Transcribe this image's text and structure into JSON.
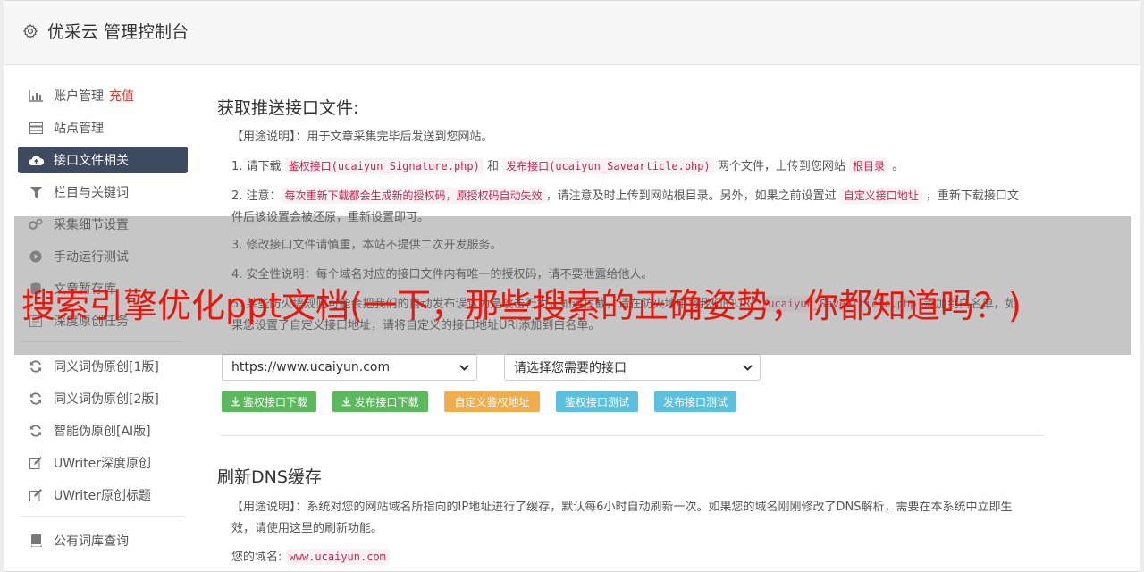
{
  "header": {
    "title": "优采云 管理控制台",
    "icon": "gear-icon"
  },
  "sidebar": {
    "items": [
      {
        "label": "账户管理",
        "badge": "充值",
        "icon": "bar-chart-icon"
      },
      {
        "label": "站点管理",
        "icon": "server-icon"
      },
      {
        "label": "接口文件相关",
        "icon": "cloud-upload-icon",
        "active": true
      },
      {
        "label": "栏目与关键词",
        "icon": "filter-icon"
      },
      {
        "label": "采集细节设置",
        "icon": "cogs-icon"
      },
      {
        "label": "手动运行测试",
        "icon": "play-circle-icon"
      },
      {
        "label": "文章暂存库",
        "icon": "database-icon"
      },
      {
        "label": "深度原创任务",
        "icon": "tasks-icon"
      },
      {
        "label": "同义词伪原创[1版]",
        "icon": "refresh-icon"
      },
      {
        "label": "同义词伪原创[2版]",
        "icon": "refresh-icon"
      },
      {
        "label": "智能伪原创[AI版]",
        "icon": "refresh-icon"
      },
      {
        "label": "UWriter深度原创",
        "icon": "edit-icon"
      },
      {
        "label": "UWriter原创标题",
        "icon": "edit-icon"
      },
      {
        "label": "公有词库查询",
        "icon": "book-icon"
      }
    ]
  },
  "section1": {
    "title": "获取推送接口文件:",
    "usage_label": "【用途说明】",
    "usage_text": "：用于文章采集完毕后发送到您网站。",
    "item1": {
      "prefix": "1. 请下载 ",
      "code1": "鉴权接口(ucaiyun_Signature.php)",
      "mid": " 和 ",
      "code2": "发布接口(ucaiyun_Savearticle.php)",
      "suffix": " 两个文件，上传到您网站 ",
      "code3": "根目录",
      "end": " 。"
    },
    "item2": {
      "prefix": "2. 注意：",
      "code1": "每次重新下载都会生成新的授权码，原授权码自动失效",
      "mid": "，请注意及时上传到网站根目录。另外，如果之前设置过 ",
      "code2": "自定义接口地址",
      "suffix": " ，重新下载接口文件后该设置会被还原，重新设置即可。"
    },
    "item3": "3. 修改接口文件请慎重，本站不提供二次开发服务。",
    "item4": "4. 安全性说明：每个域名对应的接口文件内有唯一的授权码，请不要泄露给他人。",
    "item5": {
      "text_a": "5. 某些防火墙规则可能会把我们的自动发布误认为是攻击行为，如遇拦截，请在防火墙中将我们的URI ",
      "code1": "/ucaiyun_Savearticle.php",
      "text_b": " 添加到白名单，如果您设置了自定义接口地址，请将自定义的接口地址URI添加到白名单。"
    },
    "site_select": "https://www.ucaiyun.com",
    "api_select": "请选择您需要的接口",
    "buttons": {
      "download_auth": "鉴权接口下载",
      "download_publish": "发布接口下载",
      "custom_auth": "自定义鉴权地址",
      "test_auth": "鉴权接口测试",
      "test_publish": "发布接口测试"
    }
  },
  "section2": {
    "title": "刷新DNS缓存",
    "usage_label": "【用途说明】",
    "usage_text": "：系统对您的网站域名所指向的IP地址进行了缓存，默认每6小时自动刷新一次。如果您的域名刚刚修改了DNS解析，需要在本系统中立即生效，请使用这里的刷新功能。",
    "domain_label": "您的域名:",
    "domain_value": "www.ucaiyun.com"
  },
  "overlay": {
    "title": "搜索引擎优化ppt文档(一下，那些搜索的正确姿势，你都知道吗？)"
  },
  "colors": {
    "active_nav": "#3e4a5f",
    "green": "#5cb85c",
    "orange": "#f0ad4e",
    "blue": "#5bc0de",
    "code_text": "#c7254e",
    "overlay_text": "#e8160c"
  }
}
